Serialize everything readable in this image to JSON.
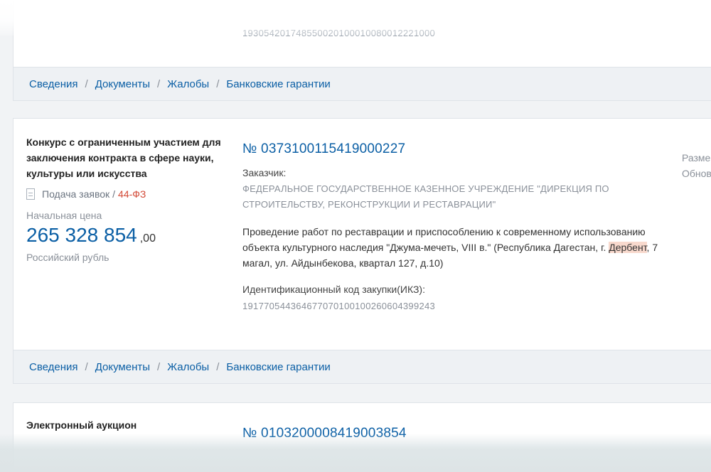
{
  "footer_links": {
    "details": "Сведения",
    "documents": "Документы",
    "complaints": "Жалобы",
    "guarantees": "Банковские гарантии",
    "separator": "/"
  },
  "card1": {
    "ikz_partial": "193054201748550020100010080012221000"
  },
  "card2": {
    "type": "Конкурс с ограниченным участием для заключения контракта в сфере науки, культуры или искусства",
    "procedure": "Подача заявок",
    "procedure_sep": "/",
    "law": "44-ФЗ",
    "price_label": "Начальная цена",
    "price": "265 328 854",
    "price_cents": ",00",
    "currency": "Российский рубль",
    "number": "№ 0373100115419000227",
    "customer_label": "Заказчик:",
    "customer": "ФЕДЕРАЛЬНОЕ ГОСУДАРСТВЕННОЕ КАЗЕННОЕ УЧРЕЖДЕНИЕ \"ДИРЕКЦИЯ ПО СТРОИТЕЛЬСТВУ, РЕКОНСТРУКЦИИ И РЕСТАВРАЦИИ\"",
    "desc_part1": "Проведение работ по реставрации и приспособлению к современному использованию объекта культурного наследия \"Джума-мечеть, VIII в.\" (Республика Дагестан, г. ",
    "desc_highlight": "Дербент",
    "desc_part2": ", 7 магал, ул. Айдынбекова, квартал 127, д.10)",
    "ikz_label": "Идентификационный код закупки(ИКЗ):",
    "ikz": "191770544364677070100100260604399243",
    "right_1": "Разме",
    "right_2": "Обнов"
  },
  "card3": {
    "type": "Электронный аукцион",
    "number": "№ 0103200008419003854"
  }
}
